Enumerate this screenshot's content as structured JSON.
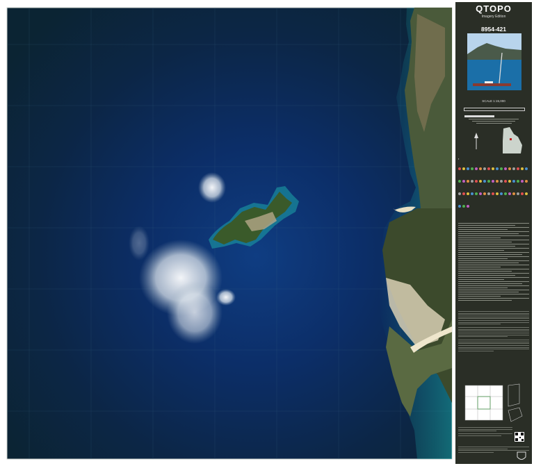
{
  "sidebar": {
    "title": "QTOPO",
    "subtitle": "Imagery Edition",
    "sheet_number": "8954-421",
    "scale_label": "SCALE 1:15,000"
  },
  "colors": {
    "deep_water": "#0c2a55",
    "shallow_water": "#1c8aa0",
    "land": "#2f4a26",
    "sidebar_bg": "#2a2e26"
  },
  "icons": [
    "queensland-locator-icon",
    "qr-code-icon",
    "qld-crest-icon",
    "north-arrow-icon"
  ]
}
